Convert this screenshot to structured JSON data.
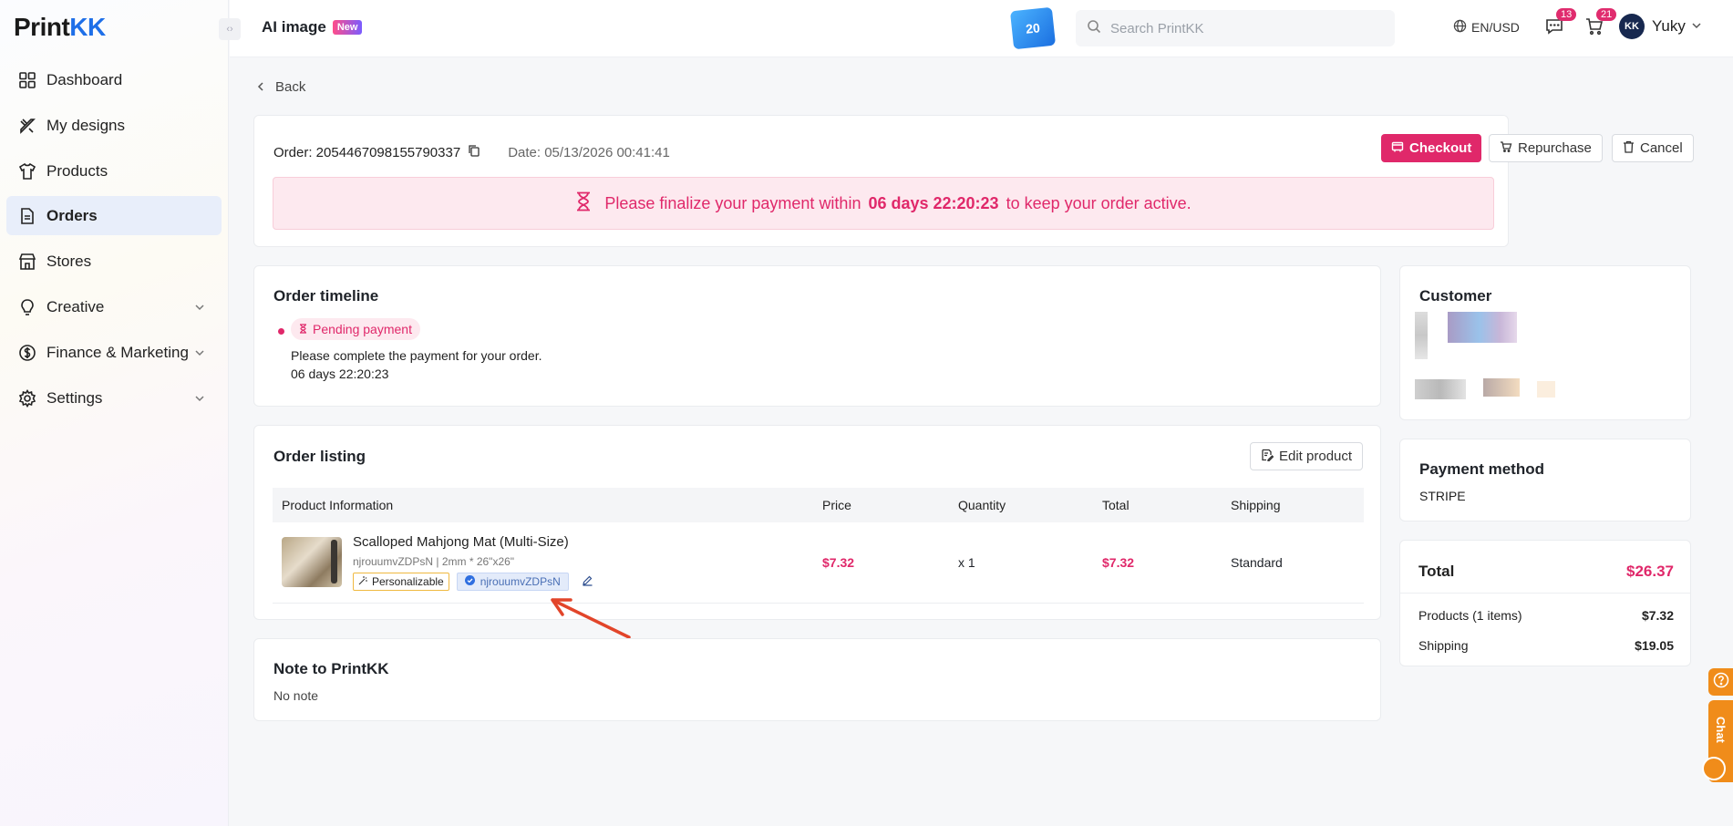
{
  "brand": {
    "logo_main": "Print",
    "logo_accent": "KK"
  },
  "sidebar": {
    "items": [
      {
        "label": "Dashboard"
      },
      {
        "label": "My designs"
      },
      {
        "label": "Products"
      },
      {
        "label": "Orders"
      },
      {
        "label": "Stores"
      },
      {
        "label": "Creative"
      },
      {
        "label": "Finance & Marketing"
      },
      {
        "label": "Settings"
      }
    ],
    "active": "Orders"
  },
  "header": {
    "ai_image": "AI image",
    "new_badge": "New",
    "promo_text": "20",
    "search_placeholder": "Search PrintKK",
    "lang": "EN/USD",
    "messages_count": "13",
    "cart_count": "21",
    "avatar_initials": "KK",
    "user_name": "Yuky"
  },
  "page": {
    "back_label": "Back",
    "order_label": "Order: 2054467098155790337",
    "date_label": "Date: 05/13/2026 00:41:41",
    "buttons": {
      "checkout": "Checkout",
      "repurchase": "Repurchase",
      "cancel": "Cancel"
    },
    "alert": {
      "prefix": "Please finalize your payment within",
      "countdown": "06 days 22:20:23",
      "suffix": "to keep your order active."
    }
  },
  "timeline": {
    "title": "Order timeline",
    "status": "Pending payment",
    "message": "Please complete the payment for your order.",
    "countdown": "06 days 22:20:23"
  },
  "listing": {
    "title": "Order listing",
    "edit_button": "Edit product",
    "columns": [
      "Product Information",
      "Price",
      "Quantity",
      "Total",
      "Shipping"
    ],
    "rows": [
      {
        "name": "Scalloped Mahjong Mat (Multi-Size)",
        "sku": "njrouumvZDPsN",
        "variant": "2mm * 26\"x26\"",
        "tag_personalizable": "Personalizable",
        "tag_id": "njrouumvZDPsN",
        "price": "$7.32",
        "quantity": "x 1",
        "total": "$7.32",
        "shipping": "Standard"
      }
    ]
  },
  "note": {
    "title": "Note to PrintKK",
    "text": "No note"
  },
  "customer": {
    "title": "Customer"
  },
  "payment": {
    "title": "Payment method",
    "method": "STRIPE"
  },
  "summary": {
    "total_label": "Total",
    "total_value": "$26.37",
    "products_label": "Products (1 items)",
    "products_value": "$7.32",
    "shipping_label": "Shipping",
    "shipping_value": "$19.05"
  },
  "support": {
    "chat_label": "Chat"
  },
  "colors": {
    "accent": "#e0286a",
    "brand_blue": "#1e6fe8",
    "help_orange": "#f08c1a"
  }
}
